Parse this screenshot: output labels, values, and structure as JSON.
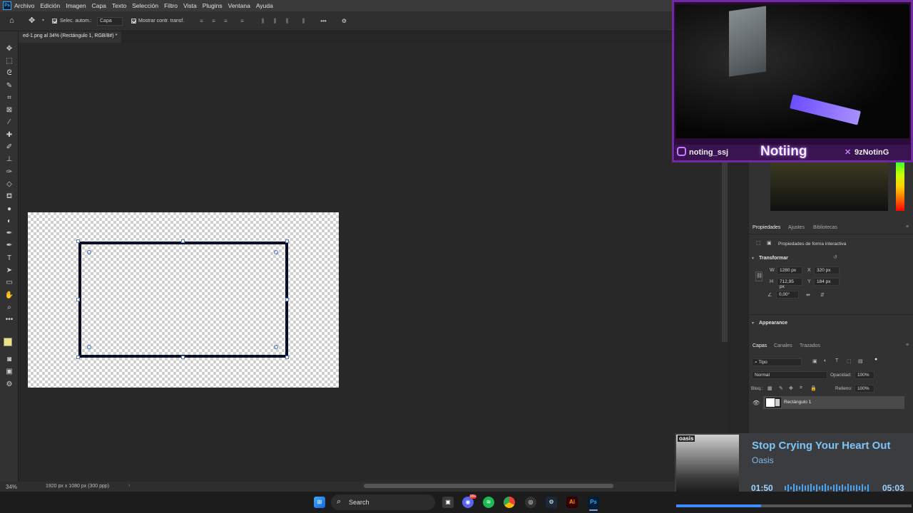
{
  "menu": {
    "app_icon": "Ps",
    "items": [
      "Archivo",
      "Edición",
      "Imagen",
      "Capa",
      "Texto",
      "Selección",
      "Filtro",
      "Vista",
      "Plugins",
      "Ventana",
      "Ayuda"
    ]
  },
  "options": {
    "auto_select_label": "Selec. autom.:",
    "auto_select_value": "Capa",
    "show_transform_label": "Mostrar contr. transf."
  },
  "document": {
    "tab_title": "ed-1.png al 34% (Rectángulo 1, RGB/8#) *",
    "zoom": "34%",
    "info": "1920 px x 1080 px (300 ppp)"
  },
  "properties": {
    "tabs": [
      "Propiedades",
      "Ajustes",
      "Bibliotecas"
    ],
    "subtitle": "Propiedades de forma interactiva",
    "section": "Transformar",
    "w_label": "W",
    "w": "1280 px",
    "h_label": "H",
    "h": "712,95 px",
    "x_label": "X",
    "x": "320 px",
    "y_label": "Y",
    "y": "184 px",
    "angle": "0,00°",
    "appearance": "Appearance"
  },
  "layers": {
    "tabs": [
      "Capas",
      "Canales",
      "Trazados"
    ],
    "filter": "Tipo",
    "blend": "Normal",
    "opacity_label": "Opacidad:",
    "opacity": "100%",
    "lock_label": "Bloq.:",
    "fill_label": "Relleno:",
    "fill": "100%",
    "layer_name": "Rectángulo 1"
  },
  "webcam": {
    "handle_left": "noting_ssj",
    "name": "Notiing",
    "handle_right": "9zNotinG"
  },
  "music": {
    "title": "Stop Crying Your Heart Out",
    "artist": "Oasis",
    "album_text": "oasis",
    "elapsed": "01:50",
    "total": "05:03",
    "progress": 0.36
  },
  "taskbar": {
    "search": "Search",
    "discord_badge": "99+"
  },
  "colors": {
    "accent": "#31a8ff",
    "cam_border": "#6f2aa0",
    "music_text": "#7fc4f5"
  }
}
